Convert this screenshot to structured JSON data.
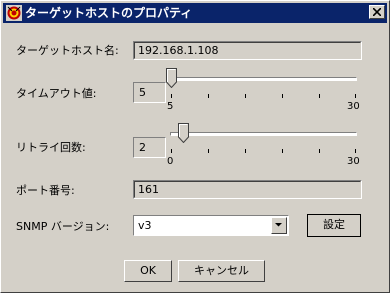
{
  "window": {
    "title": "ターゲットホストのプロパティ",
    "icon": "app-icon",
    "close_icon": "close-icon"
  },
  "fields": {
    "host_name": {
      "label": "ターゲットホスト名:",
      "value": "192.168.1.108"
    },
    "timeout": {
      "label": "タイムアウト値:",
      "value": "5",
      "min_label": "5",
      "max_label": "30",
      "level": 0
    },
    "retry": {
      "label": "リトライ回数:",
      "value": "2",
      "min_label": "0",
      "max_label": "30",
      "level": 0.067
    },
    "port": {
      "label": "ポート番号:",
      "value": "161"
    },
    "snmp_version": {
      "label": "SNMP バージョン:",
      "value": "v3",
      "settings_label": "設定"
    }
  },
  "buttons": {
    "ok": "OK",
    "cancel": "キャンセル"
  },
  "colors": {
    "title_bar": "#0a246a",
    "face": "#d4d0c8"
  }
}
